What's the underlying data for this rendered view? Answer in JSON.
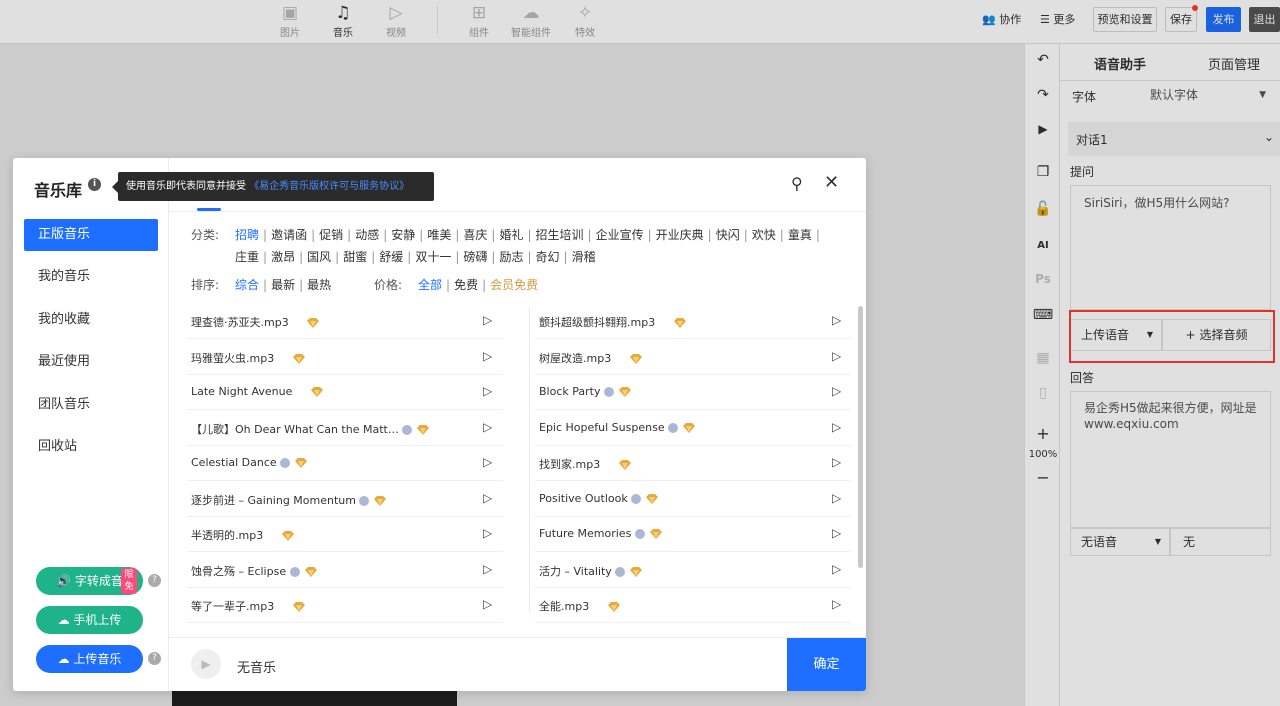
{
  "toolbar": {
    "tools": [
      {
        "label": "图片",
        "icon": "image-icon"
      },
      {
        "label": "音乐",
        "icon": "music-icon"
      },
      {
        "label": "视频",
        "icon": "video-icon"
      },
      {
        "label": "组件",
        "icon": "components-icon"
      },
      {
        "label": "智能组件",
        "icon": "ai-components-icon"
      },
      {
        "label": "特效",
        "icon": "effects-icon"
      }
    ],
    "active_tool": "音乐",
    "collab": "协作",
    "more": "更多",
    "preview": "预览和设置",
    "save": "保存",
    "publish": "发布",
    "exit": "退出"
  },
  "side_tools": {
    "zoom": "100%",
    "ai_label": "AI",
    "ps_label": "Ps"
  },
  "panel": {
    "tabs": [
      "语音助手",
      "页面管理"
    ],
    "font_label": "字体",
    "font_value": "默认字体",
    "dialog_label": "对话1",
    "question_label": "提问",
    "question_text": "SiriSiri，做H5用什么网站?",
    "upload_voice": "上传语音",
    "choose_audio": "选择音频",
    "answer_label": "回答",
    "answer_text": "易企秀H5做起来很方便，网址是www.eqxiu.com",
    "no_voice": "无语音",
    "none": "无"
  },
  "modal": {
    "title": "音乐库",
    "tooltip_prefix": "使用音乐即代表同意并接受",
    "tooltip_link": "《易企秀音乐版权许可与服务协议》",
    "nav": [
      "正版音乐",
      "我的音乐",
      "我的收藏",
      "最近使用",
      "团队音乐",
      "回收站"
    ],
    "buttons": {
      "tts": "字转成音",
      "limit_badge": "限免",
      "phone_upload": "手机上传",
      "upload_music": "上传音乐"
    },
    "filters": {
      "category_label": "分类:",
      "categories_row1": [
        "招聘",
        "邀请函",
        "促销",
        "动感",
        "安静",
        "唯美",
        "喜庆",
        "婚礼",
        "招生培训",
        "企业宣传",
        "开业庆典",
        "快闪",
        "欢快",
        "童真"
      ],
      "categories_row2": [
        "庄重",
        "激昂",
        "国风",
        "甜蜜",
        "舒缓",
        "双十一",
        "磅礴",
        "励志",
        "奇幻",
        "滑稽"
      ],
      "sort_label": "排序:",
      "sorts": [
        "综合",
        "最新",
        "最热"
      ],
      "price_label": "价格:",
      "prices": [
        "全部",
        "免费",
        "会员免费"
      ]
    },
    "songs_left": [
      {
        "name": "理查德·苏亚夫.mp3",
        "dot": false
      },
      {
        "name": "玛雅萤火虫.mp3",
        "dot": false
      },
      {
        "name": "Late Night Avenue",
        "dot": false
      },
      {
        "name": "【儿歌】Oh Dear What Can the Matt…",
        "dot": true
      },
      {
        "name": "Celestial Dance",
        "dot": true
      },
      {
        "name": "逐步前进 – Gaining Momentum",
        "dot": true
      },
      {
        "name": "半透明的.mp3",
        "dot": false
      },
      {
        "name": "蚀骨之殇 – Eclipse",
        "dot": true
      },
      {
        "name": "等了一辈子.mp3",
        "dot": false
      }
    ],
    "songs_right": [
      {
        "name": "颤抖超级颤抖翱翔.mp3",
        "dot": false
      },
      {
        "name": "树屋改造.mp3",
        "dot": false
      },
      {
        "name": "Block Party",
        "dot": true
      },
      {
        "name": "Epic Hopeful Suspense",
        "dot": true
      },
      {
        "name": "找到家.mp3",
        "dot": false
      },
      {
        "name": "Positive Outlook",
        "dot": true
      },
      {
        "name": "Future Memories",
        "dot": true
      },
      {
        "name": "活力 – Vitality",
        "dot": true
      },
      {
        "name": "全能.mp3",
        "dot": false
      }
    ],
    "footer": {
      "current": "无音乐",
      "confirm": "确定"
    }
  }
}
